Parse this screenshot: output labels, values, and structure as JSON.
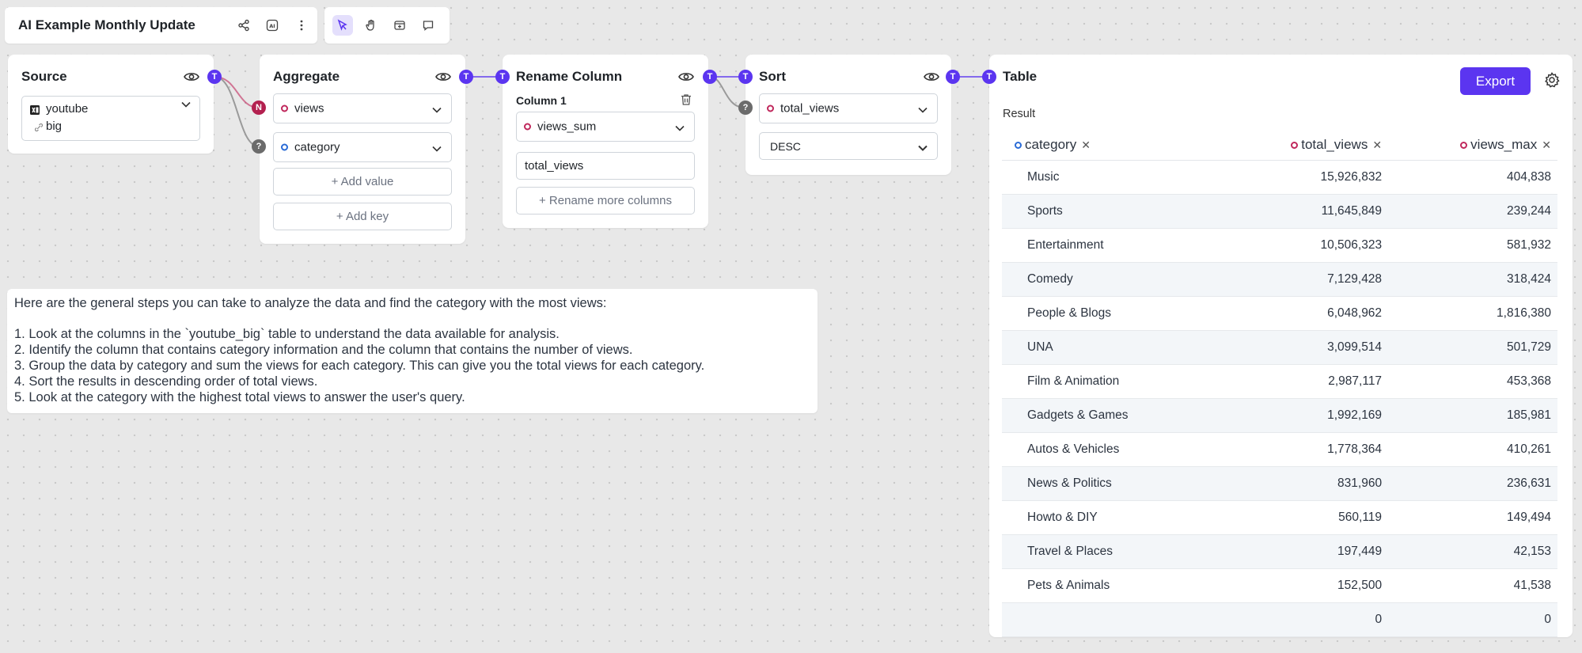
{
  "app": {
    "title": "AI Example Monthly Update"
  },
  "nodes": {
    "source": {
      "title": "Source",
      "table_line1": "youtube",
      "table_line2": "big"
    },
    "aggregate": {
      "title": "Aggregate",
      "value_field": "views",
      "key_field": "category",
      "add_value_label": "+ Add value",
      "add_key_label": "+ Add key"
    },
    "rename": {
      "title": "Rename Column",
      "column_label": "Column 1",
      "column_select": "views_sum",
      "new_name": "total_views",
      "rename_more_label": "+ Rename more columns"
    },
    "sort": {
      "title": "Sort",
      "field": "total_views",
      "order": "DESC"
    },
    "table": {
      "title": "Table",
      "export_label": "Export",
      "result_label": "Result",
      "columns": [
        "category",
        "total_views",
        "views_max"
      ],
      "rows": [
        [
          "Music",
          "15,926,832",
          "404,838"
        ],
        [
          "Sports",
          "11,645,849",
          "239,244"
        ],
        [
          "Entertainment",
          "10,506,323",
          "581,932"
        ],
        [
          "Comedy",
          "7,129,428",
          "318,424"
        ],
        [
          "People & Blogs",
          "6,048,962",
          "1,816,380"
        ],
        [
          "UNA",
          "3,099,514",
          "501,729"
        ],
        [
          "Film & Animation",
          "2,987,117",
          "453,368"
        ],
        [
          "Gadgets & Games",
          "1,992,169",
          "185,981"
        ],
        [
          "Autos & Vehicles",
          "1,778,364",
          "410,261"
        ],
        [
          "News & Politics",
          "831,960",
          "236,631"
        ],
        [
          "Howto & DIY",
          "560,119",
          "149,494"
        ],
        [
          "Travel & Places",
          "197,449",
          "42,153"
        ],
        [
          "Pets & Animals",
          "152,500",
          "41,538"
        ],
        [
          "",
          "0",
          "0"
        ]
      ]
    }
  },
  "port_labels": {
    "t": "T",
    "n": "N",
    "q": "?"
  },
  "assistant_note": {
    "intro": "Here are the general steps you can take to analyze the data and find the category with the most views:",
    "steps": [
      "1. Look at the columns in the `youtube_big` table to understand the data available for analysis.",
      "2. Identify the column that contains category information and the column that contains the number of views.",
      "3. Group the data by category and sum the views for each category. This can give you the total views for each category.",
      "4. Sort the results in descending order of total views.",
      "5. Look at the category with the highest total views to answer the user's query."
    ]
  },
  "colors": {
    "accent": "#5b35f0",
    "numeric_port": "#b3204f",
    "unknown_port": "#6b6b6b",
    "numeric_field": "#c0285c",
    "text_field": "#2a6bd6"
  }
}
